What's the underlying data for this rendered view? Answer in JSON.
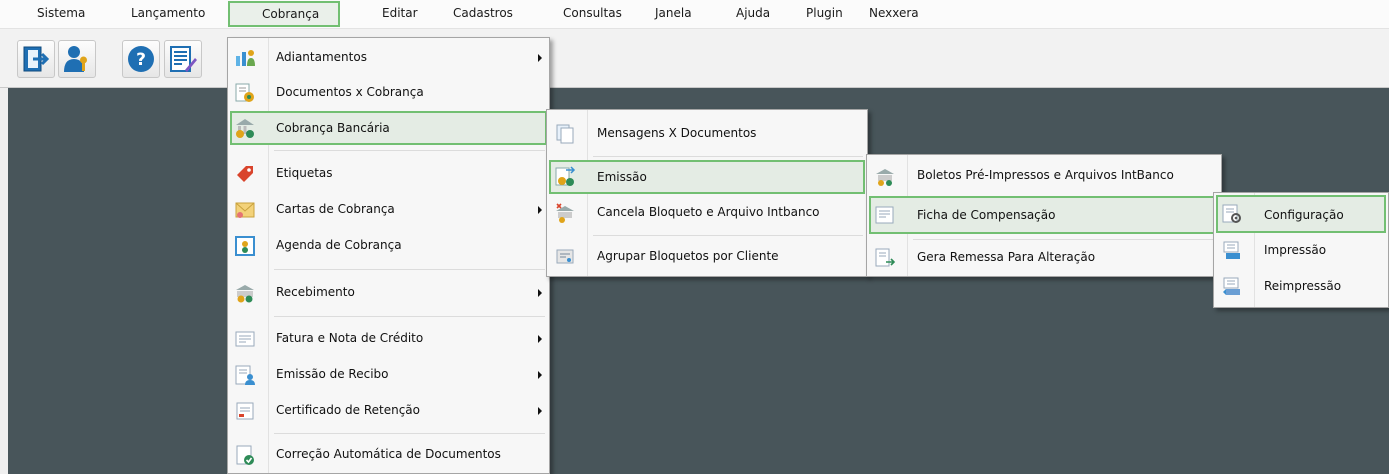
{
  "menubar": {
    "items": [
      "Sistema",
      "Lançamento",
      "Cobrança",
      "Editar",
      "Cadastros",
      "Consultas",
      "Janela",
      "Ajuda",
      "Plugin",
      "Nexxera"
    ],
    "active_index": 2
  },
  "toolbar": {
    "buttons": [
      {
        "name": "exit-icon"
      },
      {
        "name": "user-key-icon"
      },
      {
        "name": "help-icon"
      },
      {
        "name": "form-edit-icon"
      }
    ]
  },
  "colors": {
    "workspace": "#48555a",
    "highlight_border": "#72bf72",
    "highlight_bg": "#e4ece4"
  },
  "menu_cobranca": {
    "items": [
      {
        "label": "Adiantamentos",
        "submenu": true,
        "icon": "people-chart-icon"
      },
      {
        "label": "Documentos x Cobrança",
        "submenu": false,
        "icon": "document-coins-icon"
      },
      {
        "label": "Cobrança Bancária",
        "submenu": false,
        "icon": "bank-coins-icon",
        "selected": true
      },
      {
        "label": "Etiquetas",
        "submenu": false,
        "icon": "tag-icon"
      },
      {
        "label": "Cartas de Cobrança",
        "submenu": true,
        "icon": "letter-icon"
      },
      {
        "label": "Agenda de Cobrança",
        "submenu": false,
        "icon": "agenda-icon"
      },
      {
        "label": "Recebimento",
        "submenu": true,
        "icon": "receive-money-icon"
      },
      {
        "label": "Fatura e Nota de Crédito",
        "submenu": true,
        "icon": "invoice-icon"
      },
      {
        "label": "Emissão de Recibo",
        "submenu": true,
        "icon": "receipt-icon"
      },
      {
        "label": "Certificado de Retenção",
        "submenu": true,
        "icon": "certificate-icon"
      },
      {
        "label": "Correção Automática de Documentos",
        "submenu": false,
        "icon": "auto-correct-icon"
      }
    ]
  },
  "menu_bancaria": {
    "items": [
      {
        "label": "Mensagens X Documentos",
        "icon": "messages-icon"
      },
      {
        "label": "Emissão",
        "icon": "emission-icon",
        "selected": true
      },
      {
        "label": "Cancela Bloqueto e Arquivo Intbanco",
        "icon": "cancel-slip-icon"
      },
      {
        "label": "Agrupar Bloquetos por Cliente",
        "icon": "group-slips-icon"
      }
    ]
  },
  "menu_emissao": {
    "items": [
      {
        "label": "Boletos Pré-Impressos e Arquivos IntBanco",
        "icon": "preprinted-slips-icon"
      },
      {
        "label": "Ficha de Compensação",
        "icon": "compensation-form-icon",
        "selected": true
      },
      {
        "label": "Gera Remessa Para Alteração",
        "icon": "generate-remittance-icon"
      }
    ]
  },
  "menu_ficha": {
    "items": [
      {
        "label": "Configuração",
        "icon": "configuration-icon",
        "selected": true
      },
      {
        "label": "Impressão",
        "icon": "print-icon"
      },
      {
        "label": "Reimpressão",
        "icon": "reprint-icon"
      }
    ]
  }
}
